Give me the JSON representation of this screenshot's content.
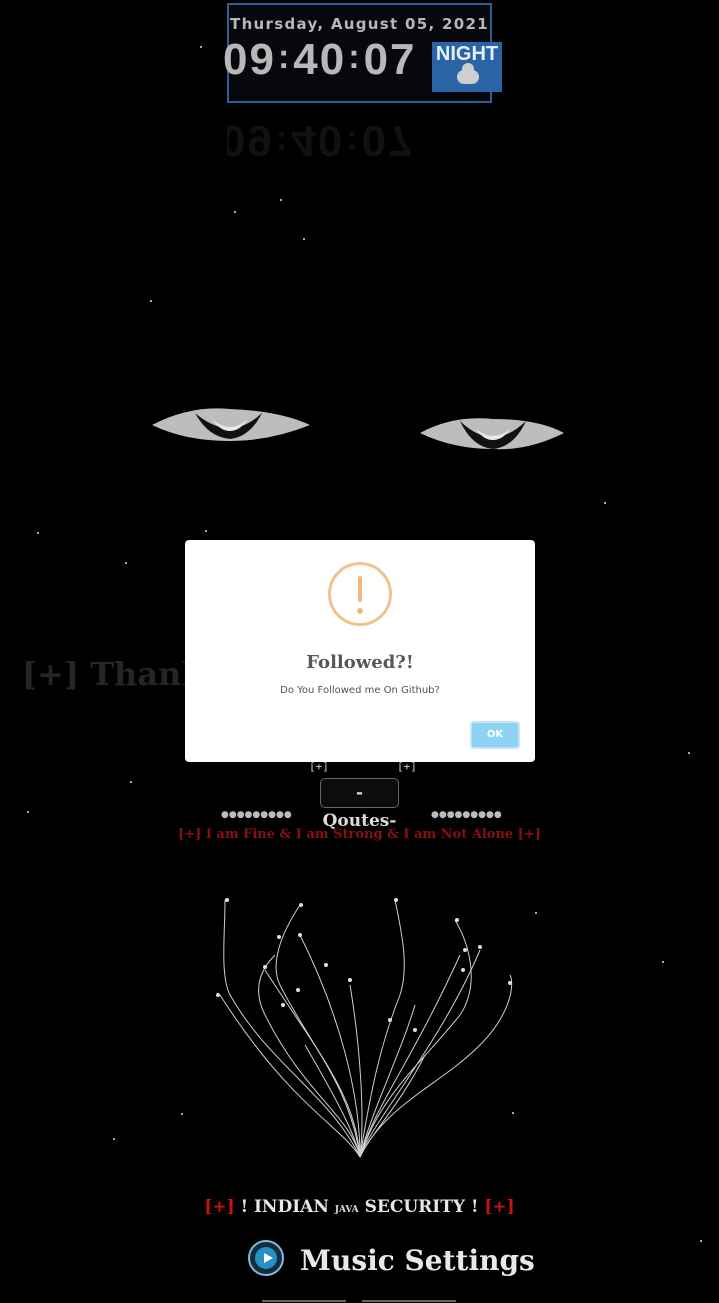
{
  "clock": {
    "date": "Thursday, August 05, 2021",
    "hours": "09",
    "minutes": "40",
    "seconds": "07",
    "period_badge": "NIGHT",
    "period_icon": "cloud-icon",
    "border_color": "#2f5f9a",
    "badge_color": "#2a63a6"
  },
  "background": {
    "color": "#000000",
    "faded_line": "[+] Thank Y"
  },
  "quotes": {
    "left_marker": "[+]",
    "right_marker": "[+]",
    "title": "-Qoutes-",
    "dots_left": "●●●●●●●●●",
    "dots_right": "●●●●●●●●●",
    "text": "[+] I am Fine & I am Strong & I am Not Alone [+]"
  },
  "footer": {
    "brand_open": "[+]",
    "brand_left": "! INDIAN",
    "brand_mid": "JAVA",
    "brand_right": "SECURITY !",
    "brand_close": "[+]",
    "music_label": "Music Settings",
    "play_icon": "play-icon"
  },
  "dialog": {
    "icon": "warning-icon",
    "title": "Followed?!",
    "message": "Do You Followed me On Github?",
    "ok_label": "OK",
    "ok_color": "#8fd3f4"
  }
}
